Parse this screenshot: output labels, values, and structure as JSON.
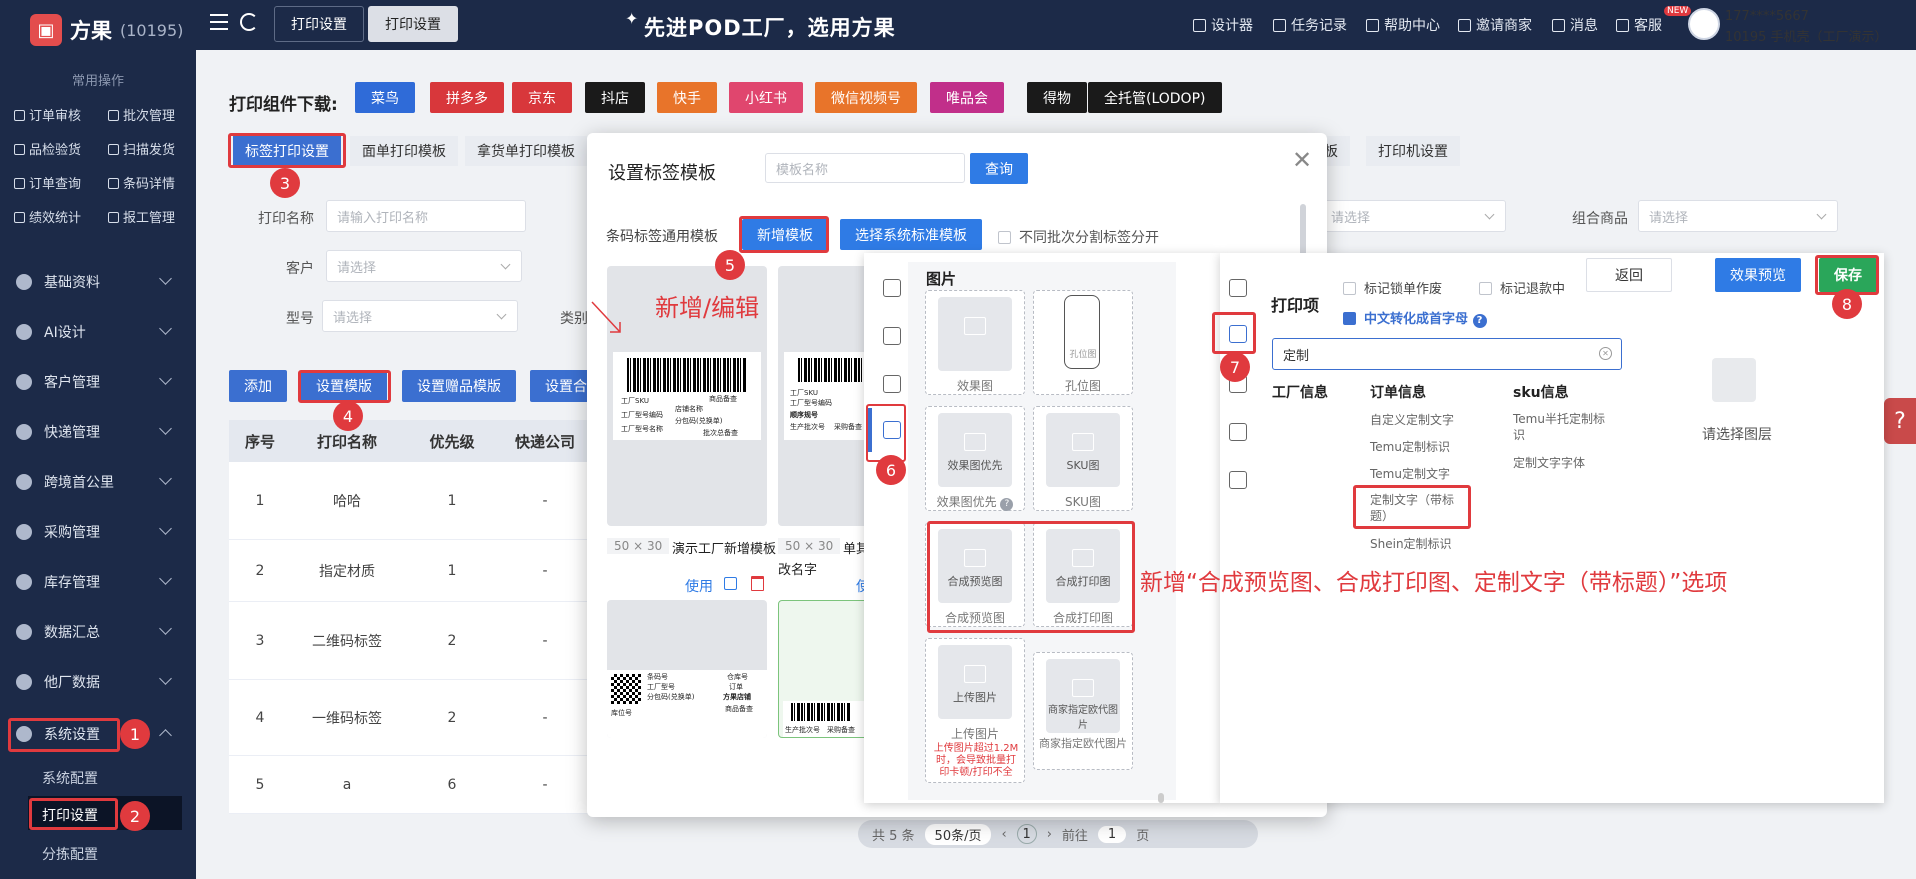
{
  "sidebar": {
    "brand": "方果",
    "brand_id": "(10195)",
    "common_title": "常用操作",
    "quick_links": [
      "订单审核",
      "批次管理",
      "品检验货",
      "扫描发货",
      "订单查询",
      "条码详情",
      "绩效统计",
      "报工管理"
    ],
    "nav": [
      "基础资料",
      "AI设计",
      "客户管理",
      "快递管理",
      "跨境首公里",
      "采购管理",
      "库存管理",
      "数据汇总",
      "他厂数据",
      "系统设置"
    ],
    "sub": [
      "系统配置",
      "打印设置",
      "分拣配置"
    ]
  },
  "topbar": {
    "tabs": [
      "打印设置",
      "打印设置"
    ],
    "slogan": "先进POD工厂，选用方果",
    "links": [
      "设计器",
      "任务记录",
      "帮助中心",
      "邀请商家",
      "消息",
      "客服"
    ],
    "new_badge": "NEW",
    "user_phone": "177****5667",
    "user_org": "10195 手机壳（工厂演示）"
  },
  "main": {
    "download_label": "打印组件下载:",
    "platforms": [
      {
        "label": "菜鸟",
        "color": "#2f6bd8"
      },
      {
        "label": "拼多多",
        "color": "#d8373b"
      },
      {
        "label": "京东",
        "color": "#d8373b"
      },
      {
        "label": "抖店",
        "color": "#1a1a1a"
      },
      {
        "label": "快手",
        "color": "#e8742a"
      },
      {
        "label": "小红书",
        "color": "#e0466e"
      },
      {
        "label": "微信视频号",
        "color": "#e8742a"
      },
      {
        "label": "唯品会",
        "color": "#c12f8a"
      },
      {
        "label": "得物",
        "color": "#1a1a1a"
      },
      {
        "label": "全托管(LODOP)",
        "color": "#1a1a1a"
      }
    ],
    "tabs": [
      "标签打印设置",
      "面单打印模板",
      "拿货单打印模板",
      "板",
      "打印机设置"
    ],
    "filters": {
      "print_name_label": "打印名称",
      "print_name_placeholder": "请输入打印名称",
      "customer_label": "客户",
      "customer_placeholder": "请选择",
      "model_label": "型号",
      "model_placeholder": "请选择",
      "category_label": "类别",
      "right_select_placeholder": "请选择",
      "combo_label": "组合商品",
      "combo_placeholder": "请选择"
    },
    "actions": [
      "添加",
      "设置模版",
      "设置赠品模版",
      "设置合"
    ],
    "table": {
      "headers": [
        "序号",
        "打印名称",
        "优先级",
        "快递公司"
      ],
      "rows": [
        [
          "1",
          "哈哈",
          "1",
          "-"
        ],
        [
          "2",
          "指定材质",
          "1",
          "-"
        ],
        [
          "3",
          "二维码标签",
          "2",
          "-"
        ],
        [
          "4",
          "一维码标签",
          "2",
          "-"
        ],
        [
          "5",
          "a",
          "6",
          "-"
        ]
      ]
    },
    "pager": {
      "total": "共 5 条",
      "size": "50条/页",
      "page": "1",
      "goto": "前往",
      "goto_val": "1",
      "unit": "页"
    }
  },
  "modal": {
    "title": "设置标签模板",
    "name_placeholder": "模板名称",
    "query": "查询",
    "group_label": "条码标签通用模板",
    "new_template": "新增模板",
    "select_std": "选择系统标准模板",
    "split_label": "不同批次分割标签分开",
    "card1_size": "50 × 30",
    "card1_name": "演示工厂新增模板",
    "card2_size": "50 × 30",
    "card2_name": "单其",
    "card2_sub": "改名字",
    "use": "使用",
    "use2": "使",
    "label_lines_1": [
      "工厂SKU",
      "商品备查",
      "店铺名称",
      "工厂型号编码",
      "分包码(兑换单)",
      "工厂型号名称",
      "批次总备查"
    ],
    "label_lines_3": [
      "条码号",
      "工厂型号",
      "分包码(兑换单)",
      "库位号",
      "仓库号",
      "订单",
      "方果店铺",
      "商品备查"
    ],
    "label_lines_2": [
      "工厂SKU",
      "工厂型号编码",
      "顺序规号",
      "生产批次号",
      "采购备查"
    ],
    "label_lines_4": [
      "生产批次号",
      "采购备查"
    ]
  },
  "editor": {
    "pic_title": "图片",
    "cells": [
      {
        "ph": "",
        "cap": "效果图"
      },
      {
        "ph": "",
        "cap": "孔位图",
        "sub": "孔位图"
      },
      {
        "ph": "效果图优先",
        "cap": "效果图优先"
      },
      {
        "ph": "SKU图",
        "cap": "SKU图"
      },
      {
        "ph": "合成预览图",
        "cap": "合成预览图"
      },
      {
        "ph": "合成打印图",
        "cap": "合成打印图"
      },
      {
        "ph": "上传图片",
        "cap": "上传图片"
      },
      {
        "ph": "商家指定欧代图片",
        "cap": "商家指定欧代图片"
      }
    ],
    "upload_warning": "上传图片超过1.2M时，会导致批量打印卡顿/打印不全",
    "print_items_title": "打印项",
    "opt_lock": "标记锁单作废",
    "opt_refund": "标记退款中",
    "opt_initial": "中文转化成首字母",
    "search_value": "定制",
    "col_factory": "工厂信息",
    "col_order": "订单信息",
    "col_sku": "sku信息",
    "order_items": [
      "自定义定制文字",
      "Temu定制标识",
      "Temu定制文字",
      "定制文字（带标题）",
      "Shein定制标识"
    ],
    "sku_items": [
      "Temu半托定制标识",
      "定制文字字体"
    ],
    "back": "返回",
    "preview": "效果预览",
    "save": "保存",
    "empty_layer": "请选择图层"
  },
  "annotations": {
    "badges": [
      "1",
      "2",
      "3",
      "4",
      "5",
      "6",
      "7",
      "8"
    ],
    "add_edit": "新增/编辑",
    "new_options": "新增“合成预览图、合成打印图、定制文字（带标题）”选项"
  }
}
